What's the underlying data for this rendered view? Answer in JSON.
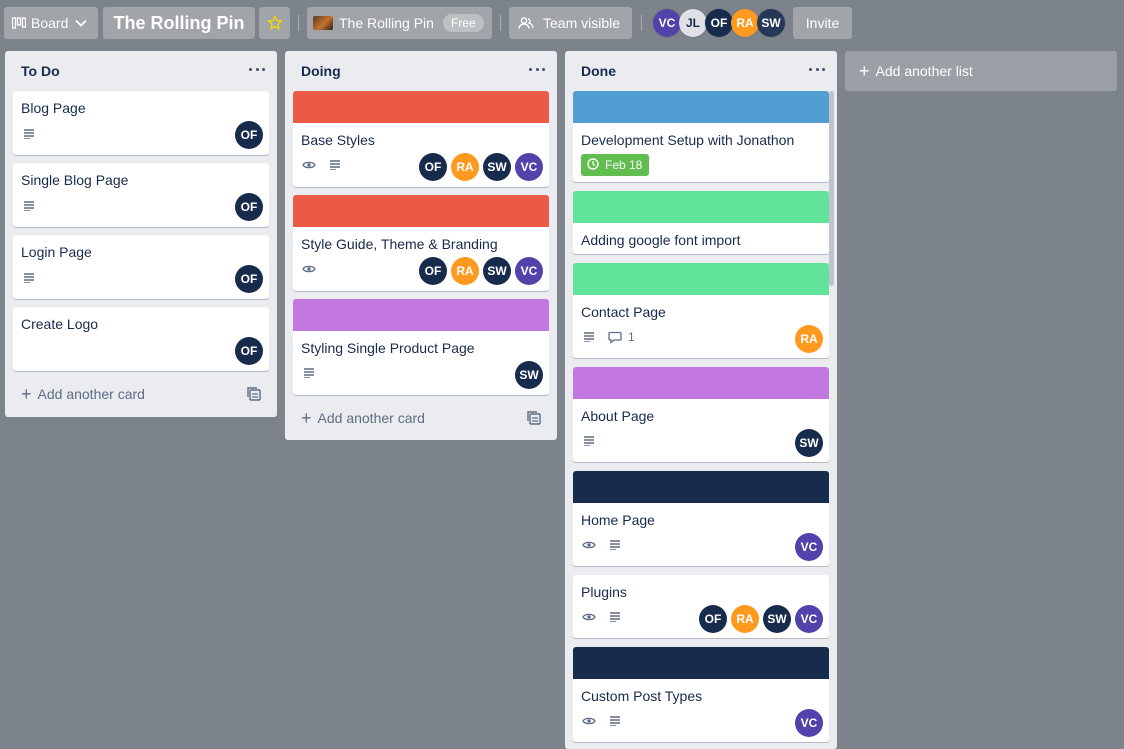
{
  "header": {
    "board_label": "Board",
    "board_title": "The Rolling Pin",
    "workspace_name": "The Rolling Pin",
    "workspace_plan": "Free",
    "visibility": "Team visible",
    "invite_label": "Invite",
    "members": [
      {
        "initials": "VC",
        "color": "#5243aa"
      },
      {
        "initials": "JL",
        "color": "#dfe1e6"
      },
      {
        "initials": "OF",
        "color": "#172b4d"
      },
      {
        "initials": "RA",
        "color": "#ff991f"
      },
      {
        "initials": "SW",
        "color": "#253858"
      }
    ]
  },
  "colors": {
    "red": "#eb5a46",
    "purple": "#c377e0",
    "blue": "#519fd2",
    "green": "#61e49a",
    "navy": "#172b4d",
    "due_green": "#61bd4f",
    "star": "#f2d600"
  },
  "lists": [
    {
      "title": "To Do",
      "add_card_label": "Add another card",
      "cards": [
        {
          "title": "Blog Page",
          "badges": [
            "description-icon"
          ],
          "members": [
            "OF"
          ]
        },
        {
          "title": "Single Blog Page",
          "badges": [
            "description-icon"
          ],
          "members": [
            "OF"
          ]
        },
        {
          "title": "Login Page",
          "badges": [
            "description-icon"
          ],
          "members": [
            "OF"
          ]
        },
        {
          "title": "Create Logo",
          "badges": [],
          "members": [
            "OF"
          ]
        }
      ]
    },
    {
      "title": "Doing",
      "add_card_label": "Add another card",
      "cards": [
        {
          "title": "Base Styles",
          "cover": "red",
          "badges": [
            "watch-icon",
            "description-icon"
          ],
          "members": [
            "OF",
            "RA",
            "SW",
            "VC"
          ]
        },
        {
          "title": "Style Guide, Theme & Branding",
          "cover": "red",
          "badges": [
            "watch-icon"
          ],
          "members": [
            "OF",
            "RA",
            "SW",
            "VC"
          ]
        },
        {
          "title": "Styling Single Product Page",
          "cover": "purple",
          "badges": [
            "description-icon"
          ],
          "members": [
            "SW"
          ]
        }
      ]
    },
    {
      "title": "Done",
      "cards": [
        {
          "title": "Development Setup with Jonathon",
          "cover": "blue",
          "due": "Feb 18"
        },
        {
          "title": "Adding google font import",
          "cover": "green"
        },
        {
          "title": "Contact Page",
          "cover": "green",
          "badges": [
            "description-icon",
            "comment-icon"
          ],
          "comments": "1",
          "members": [
            "RA"
          ]
        },
        {
          "title": "About Page",
          "cover": "purple",
          "badges": [
            "description-icon"
          ],
          "members": [
            "SW"
          ]
        },
        {
          "title": "Home Page",
          "cover": "navy",
          "badges": [
            "watch-icon",
            "description-icon"
          ],
          "members": [
            "VC"
          ]
        },
        {
          "title": "Plugins",
          "badges": [
            "watch-icon",
            "description-icon"
          ],
          "members": [
            "OF",
            "RA",
            "SW",
            "VC"
          ]
        },
        {
          "title": "Custom Post Types",
          "cover": "navy",
          "badges": [
            "watch-icon",
            "description-icon"
          ],
          "members": [
            "VC"
          ]
        }
      ]
    }
  ],
  "add_list_label": "Add another list",
  "member_colors": {
    "OF": "#172b4d",
    "RA": "#ff991f",
    "SW": "#172b4d",
    "VC": "#5243aa"
  }
}
